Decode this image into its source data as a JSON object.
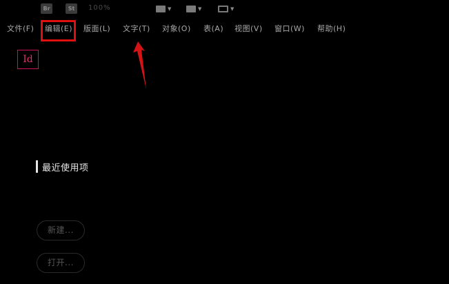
{
  "topbar": {
    "br_label": "Br",
    "st_label": "St",
    "zoom_label": "100%",
    "view_icon_1": "screen-mode-icon",
    "view_icon_2": "view-options-icon",
    "view_icon_3": "arrange-documents-icon"
  },
  "menubar": {
    "items": [
      {
        "label": "文件(F)"
      },
      {
        "label": "编辑(E)"
      },
      {
        "label": "版面(L)"
      },
      {
        "label": "文字(T)"
      },
      {
        "label": "对象(O)"
      },
      {
        "label": "表(A)"
      },
      {
        "label": "视图(V)"
      },
      {
        "label": "窗口(W)"
      },
      {
        "label": "帮助(H)"
      }
    ]
  },
  "colors": {
    "highlight": "#e01010",
    "logo_accent": "#d0145a"
  },
  "logo": {
    "label": "Id"
  },
  "recent": {
    "title": "最近使用项"
  },
  "actions": {
    "new_label": "新建...",
    "open_label": "打开..."
  }
}
